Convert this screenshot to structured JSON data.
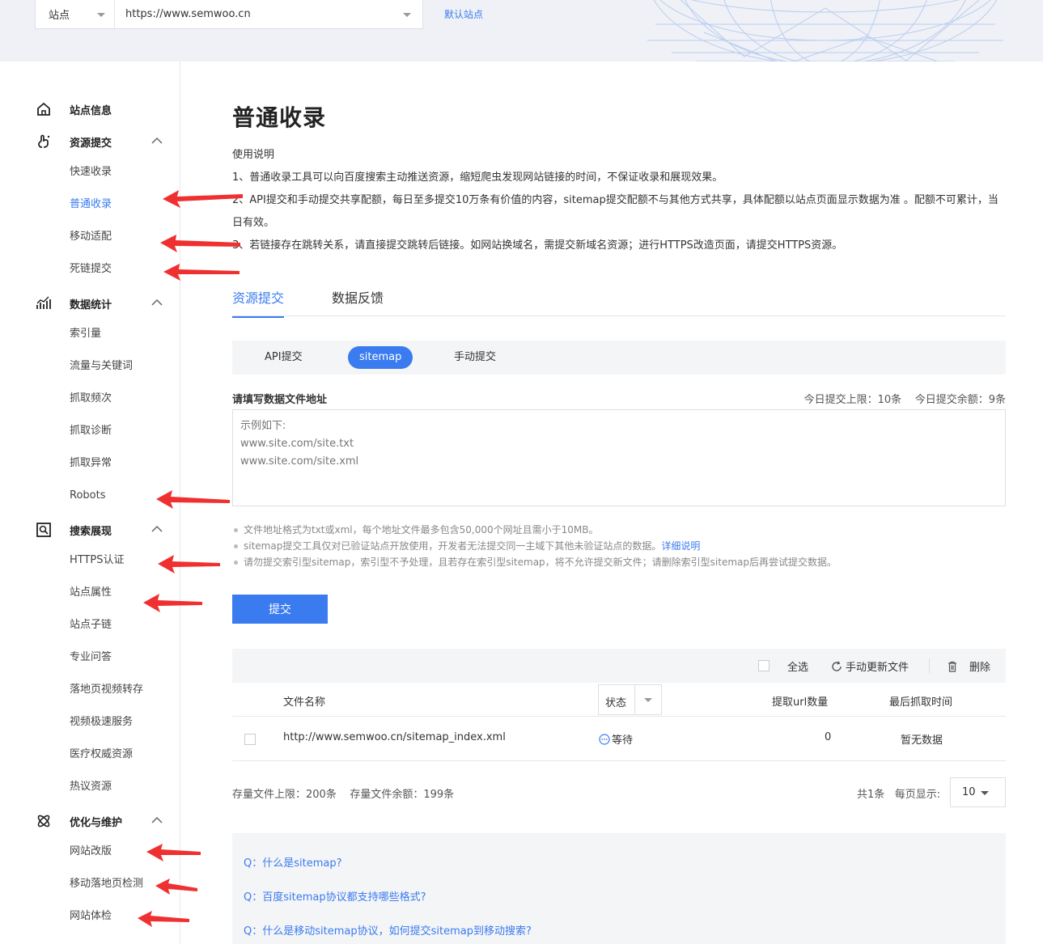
{
  "header": {
    "site_type": "站点",
    "site_url": "https://www.semwoo.cn",
    "default_site": "默认站点"
  },
  "sidebar": {
    "groups": [
      {
        "label": "站点信息",
        "icon": "home-icon"
      },
      {
        "label": "资源提交",
        "icon": "upload-hand-icon",
        "items": [
          "快速收录",
          "普通收录",
          "移动适配",
          "死链提交"
        ]
      },
      {
        "label": "数据统计",
        "icon": "chart-icon",
        "items": [
          "索引量",
          "流量与关键词",
          "抓取频次",
          "抓取诊断",
          "抓取异常",
          "Robots"
        ]
      },
      {
        "label": "搜索展现",
        "icon": "search-display-icon",
        "items": [
          "HTTPS认证",
          "站点属性",
          "站点子链",
          "专业问答",
          "落地页视频转存",
          "视频极速服务",
          "医疗权威资源",
          "热议资源"
        ]
      },
      {
        "label": "优化与维护",
        "icon": "atom-icon",
        "items": [
          "网站改版",
          "移动落地页检测",
          "网站体检"
        ]
      }
    ],
    "active_item": "普通收录"
  },
  "main": {
    "title": "普通收录",
    "usage_title": "使用说明",
    "usage_lines": [
      "1、普通收录工具可以向百度搜索主动推送资源，缩短爬虫发现网站链接的时间，不保证收录和展现效果。",
      "2、API提交和手动提交共享配额，每日至多提交10万条有价值的内容，sitemap提交配额不与其他方式共享，具体配额以站点页面显示数据为准 。配额不可累计，当日有效。",
      "3、若链接存在跳转关系，请直接提交跳转后链接。如网站换域名，需提交新域名资源；进行HTTPS改造页面，请提交HTTPS资源。"
    ],
    "tabs": [
      "资源提交",
      "数据反馈"
    ],
    "subtabs": [
      "API提交",
      "sitemap",
      "手动提交"
    ],
    "form_label": "请填写数据文件地址",
    "quota_limit": "今日提交上限：10条",
    "quota_remaining": "今日提交余额：9条",
    "textarea_placeholder": "示例如下:\nwww.site.com/site.txt\nwww.site.com/site.xml",
    "notes": [
      "文件地址格式为txt或xml，每个地址文件最多包含50,000个网址且需小于10MB。",
      "sitemap提交工具仅对已验证站点开放使用，开发者无法提交同一主域下其他未验证站点的数据。",
      "请勿提交索引型sitemap，索引型不予处理，且若存在索引型sitemap，将不允许提交新文件；请删除索引型sitemap后再尝试提交数据。"
    ],
    "notes_link": "详细说明",
    "submit_label": "提交",
    "toolbar": {
      "select_all": "全选",
      "refresh": "手动更新文件",
      "delete": "删除"
    },
    "table": {
      "headers": [
        "文件名称",
        "状态",
        "提取url数量",
        "最后抓取时间"
      ],
      "rows": [
        {
          "file": "http://www.semwoo.cn/sitemap_index.xml",
          "status": "等待",
          "count": "0",
          "last_crawl": "暂无数据"
        }
      ]
    },
    "storage_limit": "存量文件上限：200条",
    "storage_remaining": "存量文件余额：199条",
    "total": "共1条",
    "per_page_label": "每页显示:",
    "per_page": "10",
    "faq": [
      "Q：什么是sitemap?",
      "Q：百度sitemap协议都支持哪些格式?",
      "Q：什么是移动sitemap协议，如何提交sitemap到移动搜索?"
    ]
  },
  "colors": {
    "accent": "#3a7bf0",
    "annotation_arrow": "#f03030"
  }
}
